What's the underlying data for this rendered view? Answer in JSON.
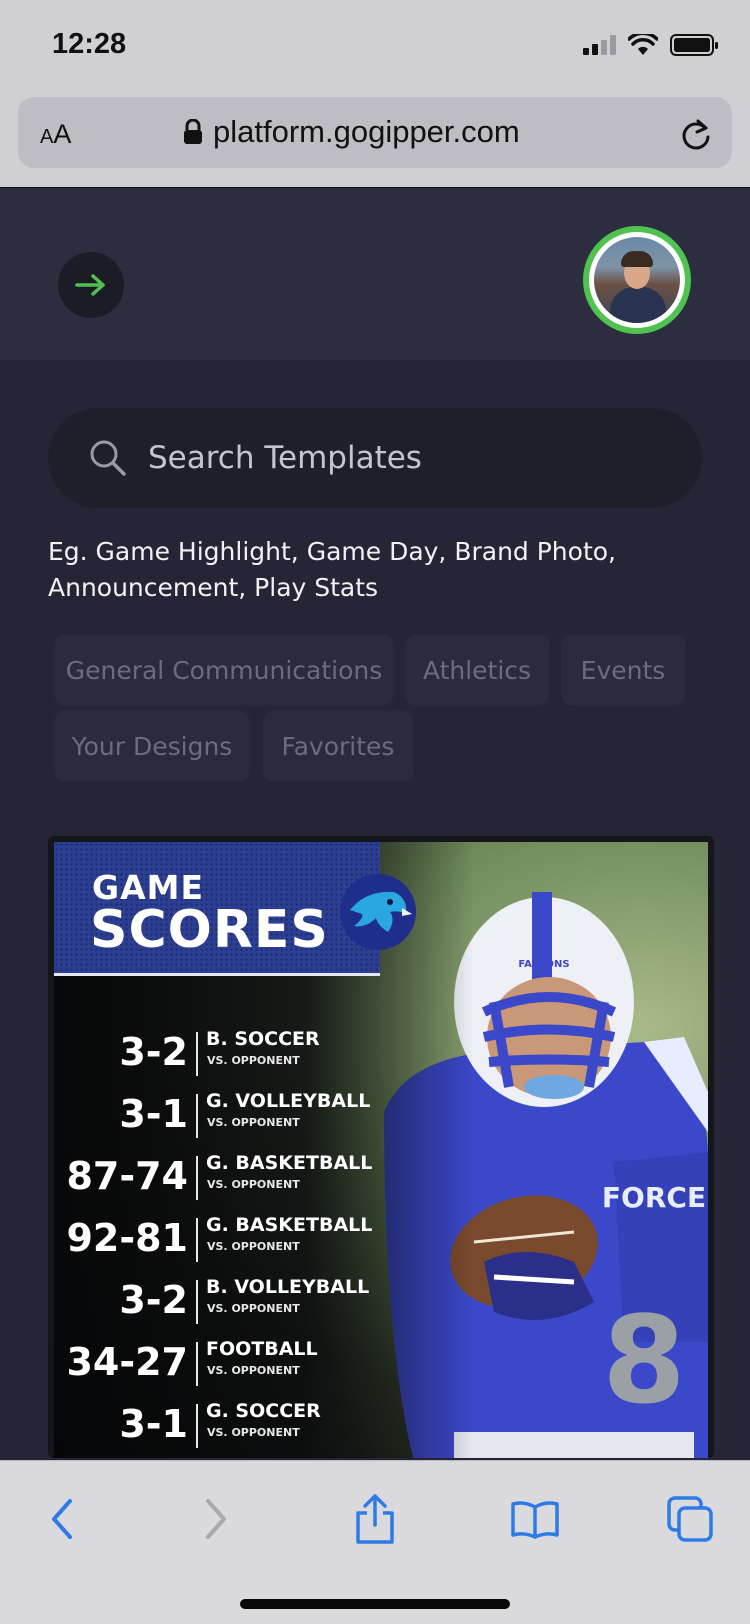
{
  "status_bar": {
    "time": "12:28"
  },
  "browser": {
    "text_size_small": "A",
    "text_size_big": "A",
    "url": "platform.gogipper.com"
  },
  "header": {
    "accent_color": "#4fc24f"
  },
  "search": {
    "placeholder": "Search Templates",
    "hint": "Eg. Game Highlight, Game Day, Brand Photo, Announcement, Play Stats"
  },
  "categories": [
    "General Communications",
    "Athletics",
    "Events",
    "Your Designs",
    "Favorites"
  ],
  "template_card": {
    "title_line1": "GAME",
    "title_line2": "SCORES",
    "jersey_text": "FORCE",
    "helmet_text": "FALCONS",
    "jersey_number": "8",
    "scores": [
      {
        "score": "3-2",
        "sport": "B. SOCCER",
        "opponent": "VS. OPPONENT"
      },
      {
        "score": "3-1",
        "sport": "G. VOLLEYBALL",
        "opponent": "VS. OPPONENT"
      },
      {
        "score": "87-74",
        "sport": "G. BASKETBALL",
        "opponent": "VS. OPPONENT"
      },
      {
        "score": "92-81",
        "sport": "G. BASKETBALL",
        "opponent": "VS. OPPONENT"
      },
      {
        "score": "3-2",
        "sport": "B. VOLLEYBALL",
        "opponent": "VS. OPPONENT"
      },
      {
        "score": "34-27",
        "sport": "FOOTBALL",
        "opponent": "VS. OPPONENT"
      },
      {
        "score": "3-1",
        "sport": "G. SOCCER",
        "opponent": "VS. OPPONENT"
      }
    ]
  },
  "toolbar": {
    "icon_color": "#2f7be6"
  }
}
